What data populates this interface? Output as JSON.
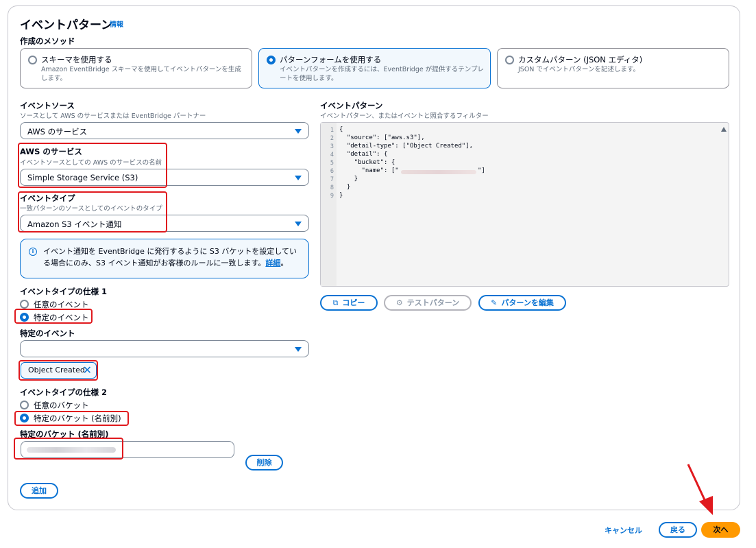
{
  "panel": {
    "title": "イベントパターン",
    "info_link": "情報"
  },
  "method": {
    "label": "作成のメソッド",
    "options": [
      {
        "title": "スキーマを使用する",
        "desc": "Amazon EventBridge スキーマを使用してイベントパターンを生成します。",
        "selected": false
      },
      {
        "title": "パターンフォームを使用する",
        "desc": "イベントパターンを作成するには、EventBridge が提供するテンプレートを使用します。",
        "selected": true
      },
      {
        "title": "カスタムパターン (JSON エディタ)",
        "desc": "JSON でイベントパターンを記述します。",
        "selected": false
      }
    ]
  },
  "event_source": {
    "label": "イベントソース",
    "desc": "ソースとして AWS のサービスまたは EventBridge パートナー",
    "value": "AWS のサービス"
  },
  "aws_service": {
    "label": "AWS のサービス",
    "desc": "イベントソースとしての AWS のサービスの名前",
    "value": "Simple Storage Service (S3)"
  },
  "event_type": {
    "label": "イベントタイプ",
    "desc": "一致パターンのソースとしてのイベントのタイプ",
    "value": "Amazon S3 イベント通知"
  },
  "alert": {
    "text": "イベント通知を EventBridge に発行するように S3 バケットを設定している場合にのみ、S3 イベント通知がお客様のルールに一致します。",
    "link": "詳細",
    "suffix": "。"
  },
  "spec1": {
    "label": "イベントタイプの仕様 1",
    "options": [
      {
        "label": "任意のイベント",
        "selected": false
      },
      {
        "label": "特定のイベント",
        "selected": true
      }
    ]
  },
  "specific_event": {
    "label": "特定のイベント",
    "value": "",
    "token": "Object Created"
  },
  "spec2": {
    "label": "イベントタイプの仕様 2",
    "options": [
      {
        "label": "任意のバケット",
        "selected": false
      },
      {
        "label": "特定のバケット (名前別)",
        "selected": true
      }
    ]
  },
  "specific_bucket": {
    "label": "特定のバケット (名前別)",
    "remove_button": "削除",
    "add_button": "追加"
  },
  "pattern": {
    "label": "イベントパターン",
    "desc": "イベントパターン、またはイベントと照合するフィルター",
    "lines": [
      "{",
      "  \"source\": [\"aws.s3\"],",
      "  \"detail-type\": [\"Object Created\"],",
      "  \"detail\": {",
      "    \"bucket\": {",
      "      \"name\": [\"",
      "    }",
      "  }",
      "}"
    ],
    "line_numbers": [
      "1",
      "2",
      "3",
      "4",
      "5",
      "6",
      "7",
      "8",
      "9"
    ],
    "copy_button": "コピー",
    "test_button": "テストパターン",
    "edit_button": "パターンを編集"
  },
  "footer": {
    "cancel": "キャンセル",
    "back": "戻る",
    "next": "次へ"
  },
  "colors": {
    "accent": "#0972d3",
    "primary_button": "#ff9900",
    "highlight": "#e0191e"
  }
}
